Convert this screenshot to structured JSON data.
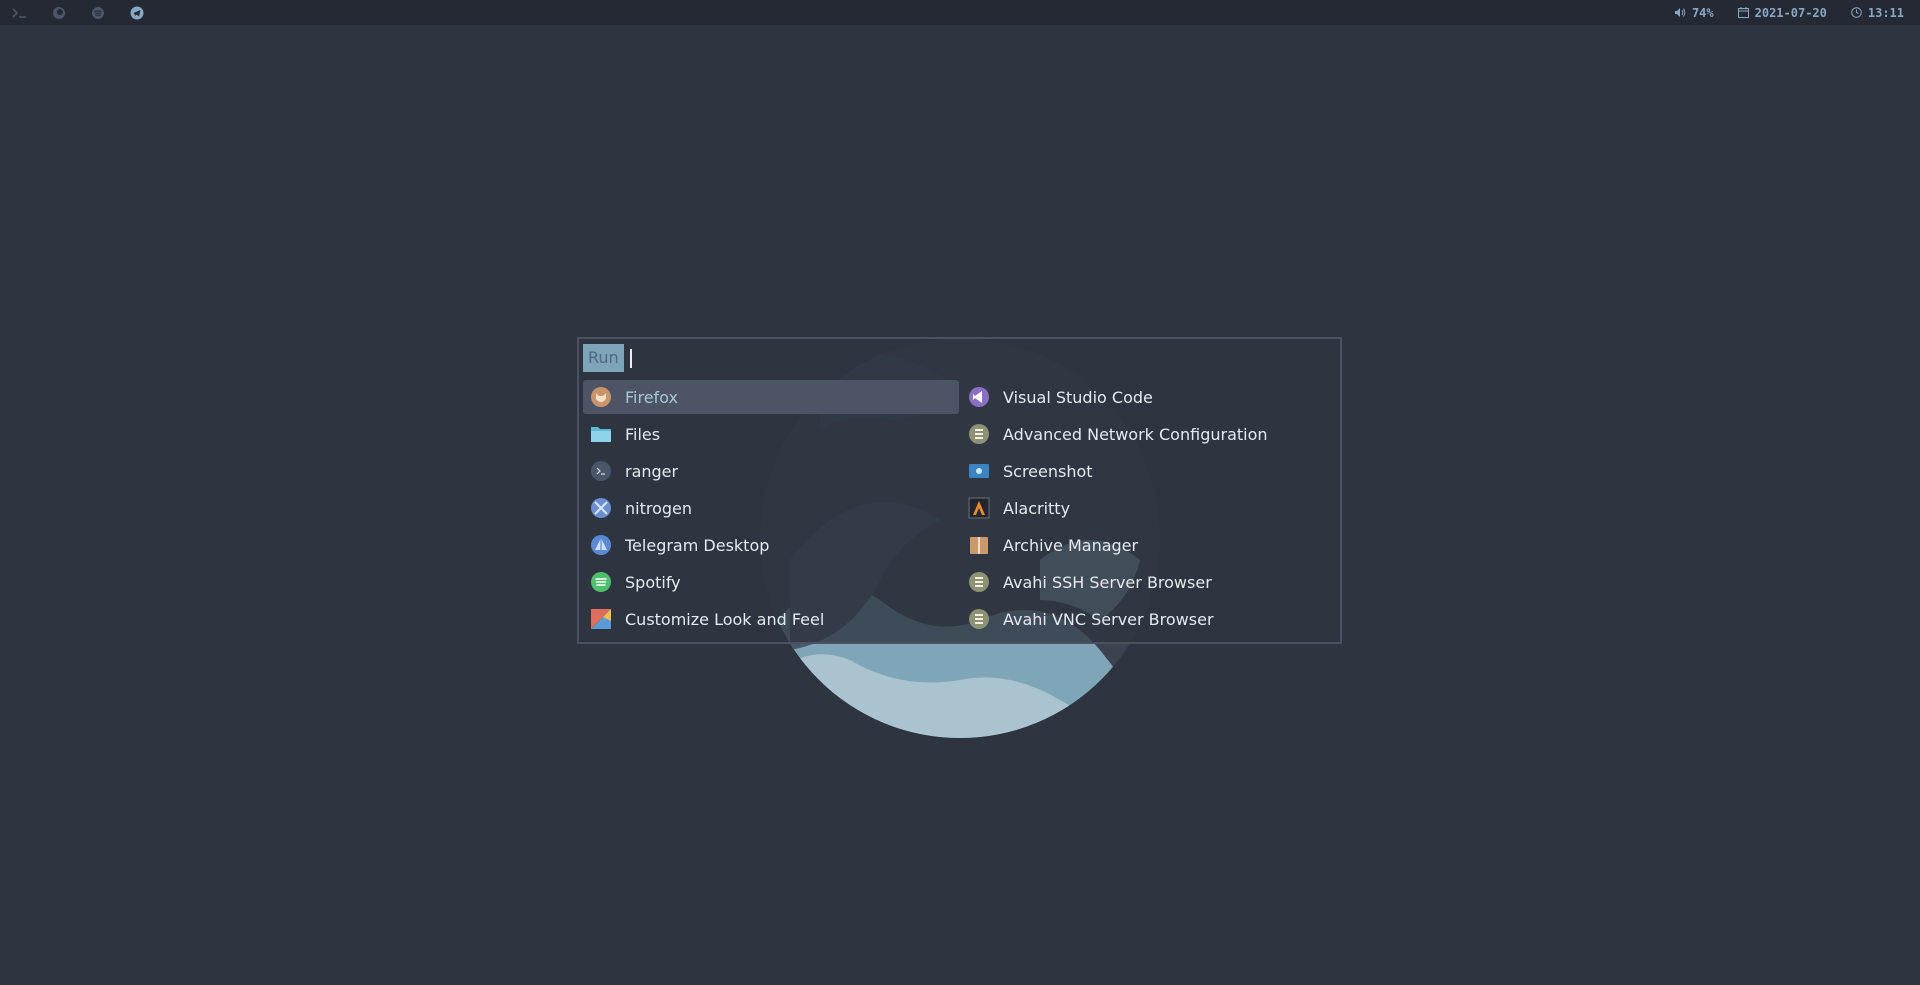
{
  "topbar": {
    "left_icons": [
      "terminal-icon",
      "firefox-icon",
      "spotify-icon",
      "telegram-icon"
    ],
    "volume": "74%",
    "date": "2021-07-20",
    "time": "13:11"
  },
  "launcher": {
    "prompt_label": "Run",
    "input_value": "",
    "selected_index": 0,
    "left_entries": [
      {
        "label": "Firefox",
        "icon": "firefox-icon"
      },
      {
        "label": "Files",
        "icon": "folder-icon"
      },
      {
        "label": "ranger",
        "icon": "terminal-icon"
      },
      {
        "label": "nitrogen",
        "icon": "nitrogen-icon"
      },
      {
        "label": "Telegram Desktop",
        "icon": "telegram-icon"
      },
      {
        "label": "Spotify",
        "icon": "spotify-icon"
      },
      {
        "label": "Customize Look and Feel",
        "icon": "appearance-icon"
      }
    ],
    "right_entries": [
      {
        "label": "Visual Studio Code",
        "icon": "vscode-icon"
      },
      {
        "label": "Advanced Network Configuration",
        "icon": "network-icon"
      },
      {
        "label": "Screenshot",
        "icon": "screenshot-icon"
      },
      {
        "label": "Alacritty",
        "icon": "alacritty-icon"
      },
      {
        "label": "Archive Manager",
        "icon": "archive-icon"
      },
      {
        "label": "Avahi SSH Server Browser",
        "icon": "avahi-icon"
      },
      {
        "label": "Avahi VNC Server Browser",
        "icon": "avahi-icon"
      }
    ]
  },
  "colors": {
    "background": "#2e3440",
    "topbar": "#242933",
    "accent": "#88a8c6",
    "selection": "#4c5466",
    "prompt_label_bg": "#7ea4b8"
  }
}
